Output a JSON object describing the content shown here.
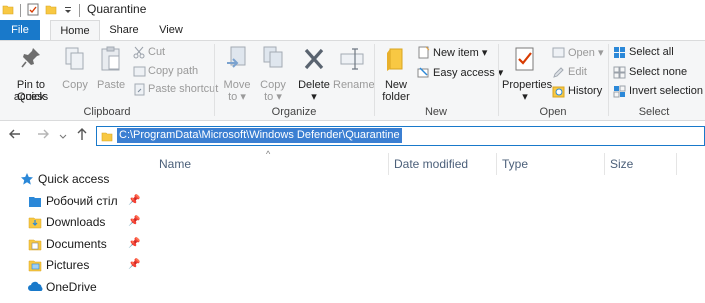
{
  "window": {
    "title": "Quarantine"
  },
  "tabs": {
    "file": "File",
    "home": "Home",
    "share": "Share",
    "view": "View"
  },
  "ribbon": {
    "clipboard": {
      "pin_line1": "Pin to Quick",
      "pin_line2": "access",
      "copy": "Copy",
      "paste": "Paste",
      "cut": "Cut",
      "copy_path": "Copy path",
      "paste_shortcut": "Paste shortcut",
      "group": "Clipboard"
    },
    "organize": {
      "move_to": "Move",
      "move_to2": "to",
      "copy_to": "Copy",
      "copy_to2": "to",
      "delete": "Delete",
      "rename": "Rename",
      "group": "Organize"
    },
    "new": {
      "new_folder1": "New",
      "new_folder2": "folder",
      "new_item": "New item",
      "easy_access": "Easy access",
      "group": "New"
    },
    "open": {
      "properties": "Properties",
      "open": "Open",
      "edit": "Edit",
      "history": "History",
      "group": "Open"
    },
    "select": {
      "select_all": "Select all",
      "select_none": "Select none",
      "invert": "Invert selection",
      "group": "Select"
    }
  },
  "address": {
    "path": "C:\\ProgramData\\Microsoft\\Windows Defender\\Quarantine"
  },
  "columns": {
    "name": "Name",
    "date": "Date modified",
    "type": "Type",
    "size": "Size"
  },
  "nav_pane": {
    "quick_access": "Quick access",
    "items": [
      {
        "label": "Робочий стіл",
        "icon": "desktop-folder-icon"
      },
      {
        "label": "Downloads",
        "icon": "downloads-folder-icon"
      },
      {
        "label": "Documents",
        "icon": "documents-folder-icon"
      },
      {
        "label": "Pictures",
        "icon": "pictures-folder-icon"
      }
    ],
    "onedrive": "OneDrive"
  },
  "colors": {
    "accent": "#1979ca",
    "selection": "#3b7fd2",
    "folder": "#f8c843"
  }
}
